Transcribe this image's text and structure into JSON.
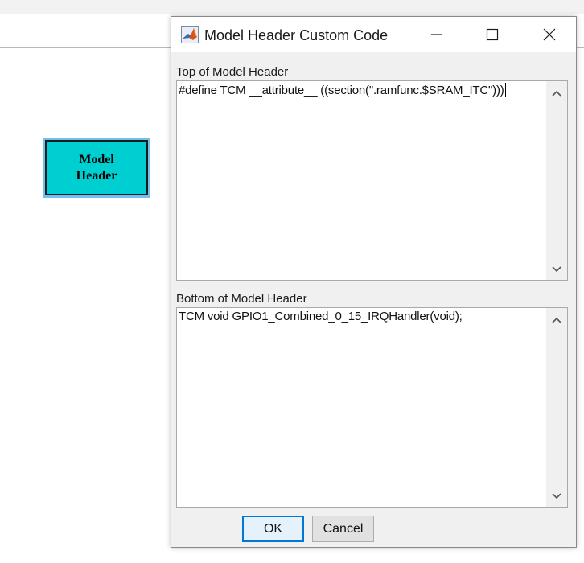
{
  "block": {
    "line1": "Model",
    "line2": "Header"
  },
  "dialog": {
    "title": "Model Header Custom Code",
    "top_label": "Top of Model Header",
    "top_value": "#define TCM __attribute__ ((section(\".ramfunc.$SRAM_ITC\")))",
    "bottom_label": "Bottom of Model Header",
    "bottom_value": "TCM void GPIO1_Combined_0_15_IRQHandler(void);",
    "ok_label": "OK",
    "cancel_label": "Cancel"
  },
  "icons": {
    "app": "matlab-icon",
    "minimize": "minimize-icon",
    "maximize": "maximize-icon",
    "close": "close-icon",
    "scroll_up": "chevron-up-icon",
    "scroll_down": "chevron-down-icon"
  },
  "colors": {
    "block_fill": "#00cfd1",
    "block_selection": "#6ec1f2",
    "ok_border": "#0078d7"
  }
}
